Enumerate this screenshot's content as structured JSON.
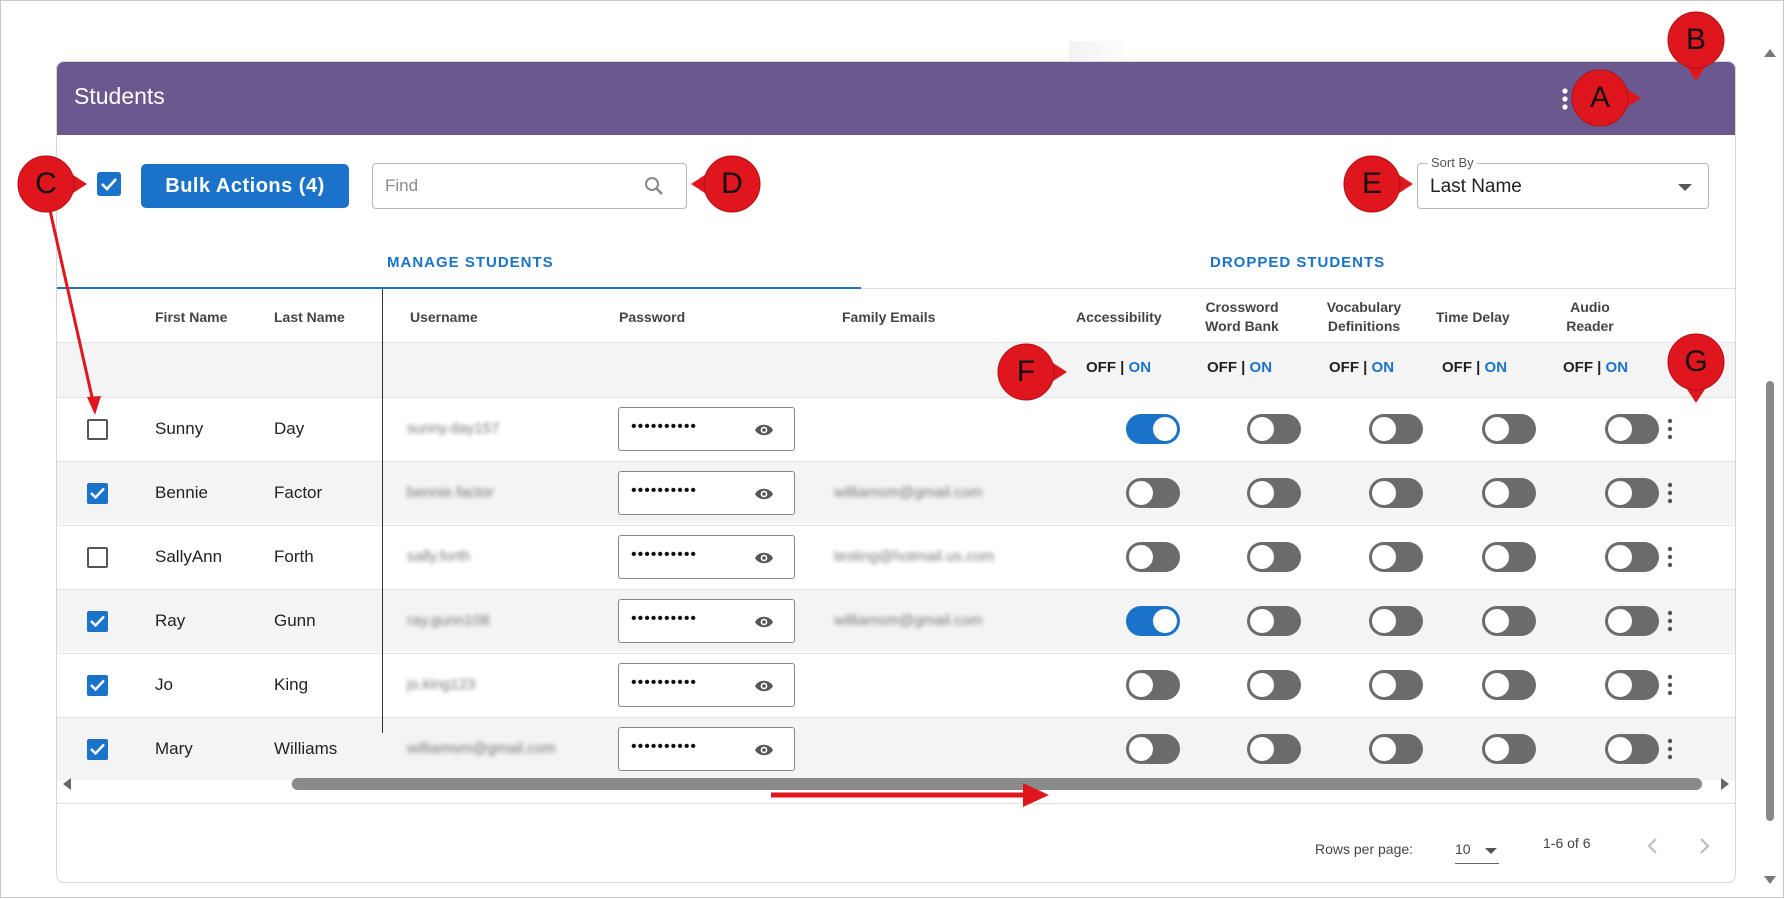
{
  "header": {
    "title": "Students"
  },
  "toolbar": {
    "bulk_label": "Bulk Actions (4)",
    "find_placeholder": "Find",
    "sort_label": "Sort By",
    "sort_value": "Last Name"
  },
  "tabs": [
    {
      "label": "MANAGE STUDENTS",
      "active": true
    },
    {
      "label": "DROPPED STUDENTS",
      "active": false
    }
  ],
  "columns": {
    "first_name": "First Name",
    "last_name": "Last Name",
    "username": "Username",
    "password": "Password",
    "family_emails": "Family Emails",
    "accessibility": "Accessibility",
    "crossword_1": "Crossword",
    "crossword_2": "Word Bank",
    "vocab_1": "Vocabulary",
    "vocab_2": "Definitions",
    "time_delay": "Time Delay",
    "audio_1": "Audio",
    "audio_2": "Reader"
  },
  "offon": {
    "off": "OFF",
    "sep": "|",
    "on": "ON"
  },
  "students": [
    {
      "checked": false,
      "first": "Sunny",
      "last": "Day",
      "username": "sunny.day157",
      "password": "••••••••••",
      "email": "",
      "toggles": [
        true,
        false,
        false,
        false,
        false
      ]
    },
    {
      "checked": true,
      "first": "Bennie",
      "last": "Factor",
      "username": "bennie.factor",
      "password": "••••••••••",
      "email": "williamsm@gmail.com",
      "toggles": [
        false,
        false,
        false,
        false,
        false
      ]
    },
    {
      "checked": false,
      "first": "SallyAnn",
      "last": "Forth",
      "username": "sally.forth",
      "password": "••••••••••",
      "email": "testing@hotmail.us.com",
      "toggles": [
        false,
        false,
        false,
        false,
        false
      ]
    },
    {
      "checked": true,
      "first": "Ray",
      "last": "Gunn",
      "username": "ray.gunn108",
      "password": "••••••••••",
      "email": "williamsm@gmail.com",
      "toggles": [
        true,
        false,
        false,
        false,
        false
      ]
    },
    {
      "checked": true,
      "first": "Jo",
      "last": "King",
      "username": "jo.king123",
      "password": "••••••••••",
      "email": "",
      "toggles": [
        false,
        false,
        false,
        false,
        false
      ]
    },
    {
      "checked": true,
      "first": "Mary",
      "last": "Williams",
      "username": "williamsm@gmail.com",
      "password": "••••••••••",
      "email": "",
      "toggles": [
        false,
        false,
        false,
        false,
        false
      ]
    }
  ],
  "pagination": {
    "rows_per_page_label": "Rows per page:",
    "rows_per_page": "10",
    "range": "1-6 of 6"
  },
  "callouts": [
    "A",
    "B",
    "C",
    "D",
    "E",
    "F",
    "G"
  ],
  "colors": {
    "header": "#6b588e",
    "accent": "#1a73c8",
    "callout": "#e0161e",
    "toggle_off": "#6b6b6b"
  },
  "icons": {
    "more": "more-vert-icon",
    "add_user": "person-add-icon",
    "search": "search-icon",
    "eye": "eye-icon",
    "caret": "caret-down-icon"
  }
}
